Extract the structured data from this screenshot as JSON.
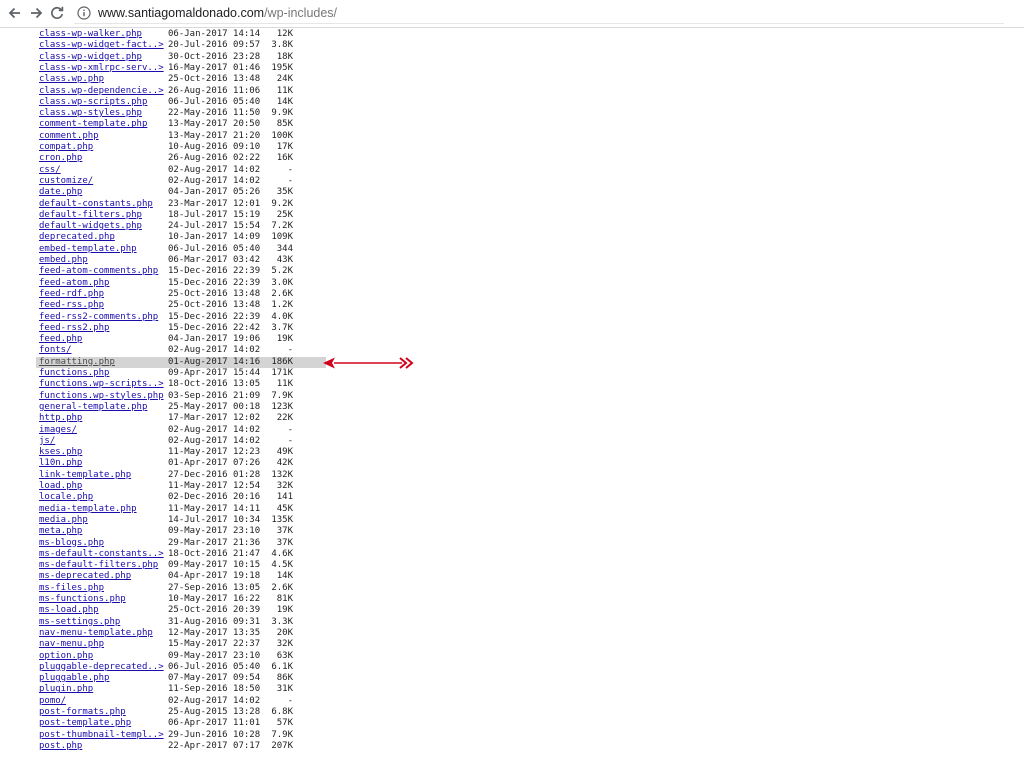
{
  "browser": {
    "url_host": "www.santiagomaldonado.com",
    "url_path": "/wp-includes/",
    "icons": {
      "back": "back-arrow-icon",
      "forward": "forward-arrow-icon",
      "reload": "reload-icon",
      "info": "info-icon"
    }
  },
  "listing": {
    "highlight_color": "#d4d4d4",
    "link_color": "#1a0dab",
    "rows": [
      {
        "name": "class-wp-walker.php",
        "date": "06-Jan-2017 14:14",
        "size": "12K"
      },
      {
        "name": "class-wp-widget-fact..>",
        "date": "20-Jul-2016 09:57",
        "size": "3.8K"
      },
      {
        "name": "class-wp-widget.php",
        "date": "30-Oct-2016 23:28",
        "size": "18K"
      },
      {
        "name": "class-wp-xmlrpc-serv..>",
        "date": "16-May-2017 01:46",
        "size": "195K"
      },
      {
        "name": "class.wp.php",
        "date": "25-Oct-2016 13:48",
        "size": "24K"
      },
      {
        "name": "class.wp-dependencie..>",
        "date": "26-Aug-2016 11:06",
        "size": "11K"
      },
      {
        "name": "class.wp-scripts.php",
        "date": "06-Jul-2016 05:40",
        "size": "14K"
      },
      {
        "name": "class.wp-styles.php",
        "date": "22-May-2016 11:50",
        "size": "9.9K"
      },
      {
        "name": "comment-template.php",
        "date": "13-May-2017 20:50",
        "size": "85K"
      },
      {
        "name": "comment.php",
        "date": "13-May-2017 21:20",
        "size": "100K"
      },
      {
        "name": "compat.php",
        "date": "10-Aug-2016 09:10",
        "size": "17K"
      },
      {
        "name": "cron.php",
        "date": "26-Aug-2016 02:22",
        "size": "16K"
      },
      {
        "name": "css/",
        "date": "02-Aug-2017 14:02",
        "size": "-"
      },
      {
        "name": "customize/",
        "date": "02-Aug-2017 14:02",
        "size": "-"
      },
      {
        "name": "date.php",
        "date": "04-Jan-2017 05:26",
        "size": "35K"
      },
      {
        "name": "default-constants.php",
        "date": "23-Mar-2017 12:01",
        "size": "9.2K"
      },
      {
        "name": "default-filters.php",
        "date": "18-Jul-2017 15:19",
        "size": "25K"
      },
      {
        "name": "default-widgets.php",
        "date": "24-Jul-2017 15:54",
        "size": "7.2K"
      },
      {
        "name": "deprecated.php",
        "date": "10-Jan-2017 14:09",
        "size": "109K"
      },
      {
        "name": "embed-template.php",
        "date": "06-Jul-2016 05:40",
        "size": "344"
      },
      {
        "name": "embed.php",
        "date": "06-Mar-2017 03:42",
        "size": "43K"
      },
      {
        "name": "feed-atom-comments.php",
        "date": "15-Dec-2016 22:39",
        "size": "5.2K"
      },
      {
        "name": "feed-atom.php",
        "date": "15-Dec-2016 22:39",
        "size": "3.0K"
      },
      {
        "name": "feed-rdf.php",
        "date": "25-Oct-2016 13:48",
        "size": "2.6K"
      },
      {
        "name": "feed-rss.php",
        "date": "25-Oct-2016 13:48",
        "size": "1.2K"
      },
      {
        "name": "feed-rss2-comments.php",
        "date": "15-Dec-2016 22:39",
        "size": "4.0K"
      },
      {
        "name": "feed-rss2.php",
        "date": "15-Dec-2016 22:42",
        "size": "3.7K"
      },
      {
        "name": "feed.php",
        "date": "04-Jan-2017 19:06",
        "size": "19K"
      },
      {
        "name": "fonts/",
        "date": "02-Aug-2017 14:02",
        "size": "-"
      },
      {
        "name": "formatting.php",
        "date": "01-Aug-2017 14:16",
        "size": "186K",
        "highlighted": true
      },
      {
        "name": "functions.php",
        "date": "09-Apr-2017 15:44",
        "size": "171K"
      },
      {
        "name": "functions.wp-scripts..>",
        "date": "18-Oct-2016 13:05",
        "size": "11K"
      },
      {
        "name": "functions.wp-styles.php",
        "date": "03-Sep-2016 21:09",
        "size": "7.9K"
      },
      {
        "name": "general-template.php",
        "date": "25-May-2017 00:18",
        "size": "123K"
      },
      {
        "name": "http.php",
        "date": "17-Mar-2017 12:02",
        "size": "22K"
      },
      {
        "name": "images/",
        "date": "02-Aug-2017 14:02",
        "size": "-"
      },
      {
        "name": "js/",
        "date": "02-Aug-2017 14:02",
        "size": "-"
      },
      {
        "name": "kses.php",
        "date": "11-May-2017 12:23",
        "size": "49K"
      },
      {
        "name": "l10n.php",
        "date": "01-Apr-2017 07:26",
        "size": "42K"
      },
      {
        "name": "link-template.php",
        "date": "27-Dec-2016 01:28",
        "size": "132K"
      },
      {
        "name": "load.php",
        "date": "11-May-2017 12:54",
        "size": "32K"
      },
      {
        "name": "locale.php",
        "date": "02-Dec-2016 20:16",
        "size": "141"
      },
      {
        "name": "media-template.php",
        "date": "11-May-2017 14:11",
        "size": "45K"
      },
      {
        "name": "media.php",
        "date": "14-Jul-2017 10:34",
        "size": "135K"
      },
      {
        "name": "meta.php",
        "date": "09-May-2017 23:10",
        "size": "37K"
      },
      {
        "name": "ms-blogs.php",
        "date": "29-Mar-2017 21:36",
        "size": "37K"
      },
      {
        "name": "ms-default-constants..>",
        "date": "18-Oct-2016 21:47",
        "size": "4.6K"
      },
      {
        "name": "ms-default-filters.php",
        "date": "09-May-2017 10:15",
        "size": "4.5K"
      },
      {
        "name": "ms-deprecated.php",
        "date": "04-Apr-2017 19:18",
        "size": "14K"
      },
      {
        "name": "ms-files.php",
        "date": "27-Sep-2016 13:05",
        "size": "2.6K"
      },
      {
        "name": "ms-functions.php",
        "date": "10-May-2017 16:22",
        "size": "81K"
      },
      {
        "name": "ms-load.php",
        "date": "25-Oct-2016 20:39",
        "size": "19K"
      },
      {
        "name": "ms-settings.php",
        "date": "31-Aug-2016 09:31",
        "size": "3.3K"
      },
      {
        "name": "nav-menu-template.php",
        "date": "12-May-2017 13:35",
        "size": "20K"
      },
      {
        "name": "nav-menu.php",
        "date": "15-May-2017 22:37",
        "size": "32K"
      },
      {
        "name": "option.php",
        "date": "09-May-2017 23:10",
        "size": "63K"
      },
      {
        "name": "pluggable-deprecated..>",
        "date": "06-Jul-2016 05:40",
        "size": "6.1K"
      },
      {
        "name": "pluggable.php",
        "date": "07-May-2017 09:54",
        "size": "86K"
      },
      {
        "name": "plugin.php",
        "date": "11-Sep-2016 18:50",
        "size": "31K"
      },
      {
        "name": "pomo/",
        "date": "02-Aug-2017 14:02",
        "size": "-"
      },
      {
        "name": "post-formats.php",
        "date": "25-Aug-2015 13:28",
        "size": "6.8K"
      },
      {
        "name": "post-template.php",
        "date": "06-Apr-2017 11:01",
        "size": "57K"
      },
      {
        "name": "post-thumbnail-templ..>",
        "date": "29-Jun-2016 10:28",
        "size": "7.9K"
      },
      {
        "name": "post.php",
        "date": "22-Apr-2017 07:17",
        "size": "207K"
      }
    ]
  },
  "annotation": {
    "arrow_color": "#d0021b",
    "icon": "double-headed-arrow-icon"
  }
}
